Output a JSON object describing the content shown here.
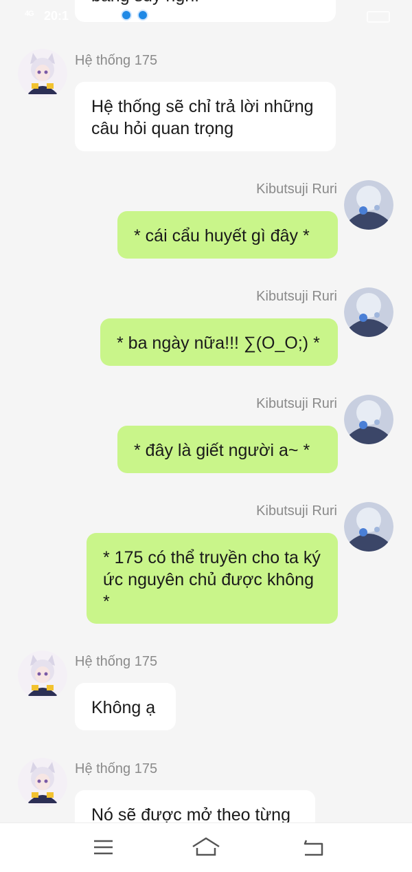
{
  "status_bar": {
    "signal": "4G",
    "time": "20:1"
  },
  "top_partial_message": {
    "text": "bằng suy nghĩ"
  },
  "messages": [
    {
      "sender": "Hệ thống 175",
      "text": "Hệ thống sẽ chỉ trả lời những câu hỏi quan trọng"
    },
    {
      "sender": "Kibutsuji Ruri",
      "text": "* cái cẩu huyết gì đây *"
    },
    {
      "sender": "Kibutsuji Ruri",
      "text": "* ba ngày nữa!!! ∑(O_O;) *"
    },
    {
      "sender": "Kibutsuji Ruri",
      "text": "* đây là giết người a~ *"
    },
    {
      "sender": "Kibutsuji Ruri",
      "text": "* 175 có thể truyền cho ta ký ức nguyên chủ được không *"
    },
    {
      "sender": "Hệ thống 175",
      "text": "Không ạ"
    },
    {
      "sender": "Hệ thống 175",
      "text": "Nó sẽ được mở theo từng"
    }
  ],
  "nav_bar": {
    "menu_icon": "menu-icon",
    "home_icon": "home-icon",
    "back_icon": "back-icon"
  },
  "colors": {
    "background": "#f5f5f5",
    "own_bubble": "#c9f58a",
    "other_bubble": "#ffffff",
    "sender_text": "#8a8a8a"
  }
}
